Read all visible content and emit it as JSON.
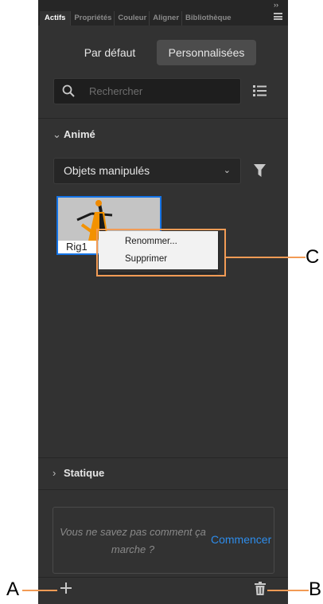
{
  "tabs": [
    "Actifs",
    "Propriétés",
    "Couleur",
    "Aligner",
    "Bibliothèque"
  ],
  "collapse_glyph": "››",
  "toggle": {
    "default_label": "Par défaut",
    "custom_label": "Personnalisées"
  },
  "search": {
    "placeholder": "Rechercher"
  },
  "section_animated": {
    "chevron": "⌄",
    "label": "Animé"
  },
  "category_dropdown": {
    "value": "Objets manipulés",
    "chevron": "⌄"
  },
  "asset": {
    "label": "Rig1"
  },
  "context_menu": {
    "items": [
      "Renommer...",
      "Supprimer"
    ]
  },
  "section_static": {
    "chevron": "›",
    "label": "Statique"
  },
  "hint": {
    "text_line1": "Vous ne savez pas comment ça",
    "text_line2": "marche ?",
    "link": "Commencer"
  },
  "callouts": {
    "a": "A",
    "b": "B",
    "c": "C"
  },
  "icons": [
    "panel-menu-icon",
    "search-icon",
    "list-view-icon",
    "filter-icon",
    "add-icon",
    "trash-icon"
  ],
  "colors": {
    "panel": "#323232",
    "selection": "#1473e6",
    "callout": "#f29b55",
    "link": "#2d8ceb"
  }
}
